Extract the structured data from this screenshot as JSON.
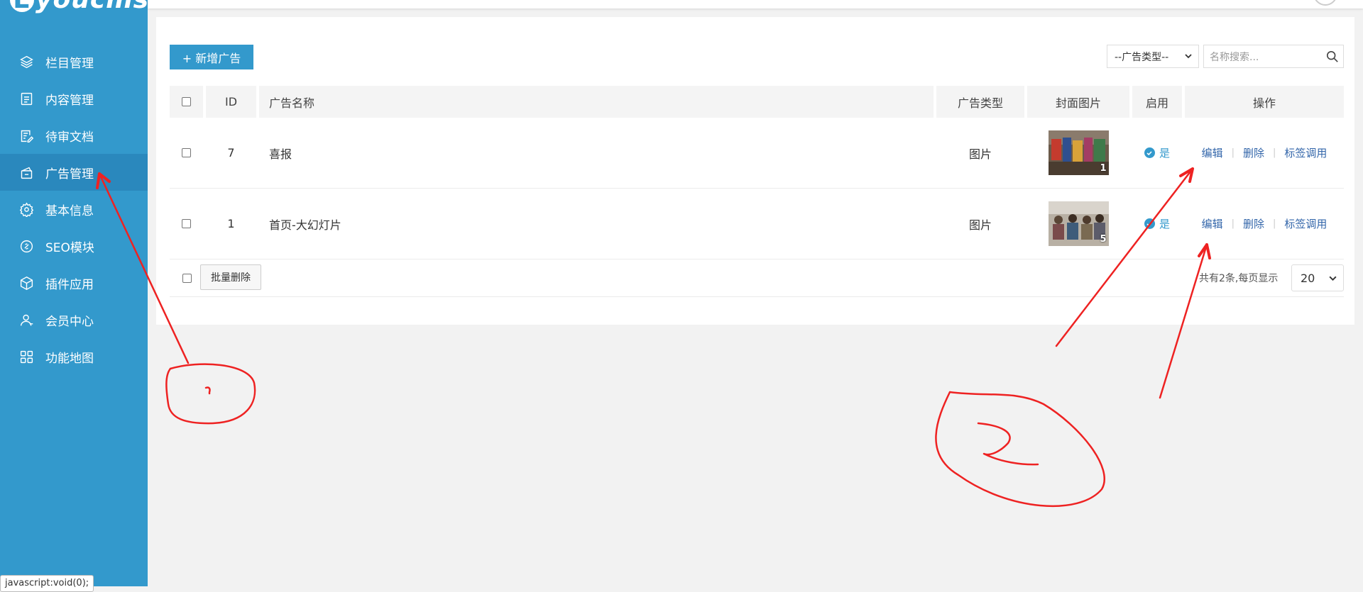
{
  "app": {
    "logo_text": "youcms",
    "logo_letter": "E"
  },
  "sidebar": {
    "items": [
      {
        "label": "栏目管理",
        "icon": "layers-icon",
        "active": false
      },
      {
        "label": "内容管理",
        "icon": "document-list-icon",
        "active": false
      },
      {
        "label": "待审文档",
        "icon": "review-document-icon",
        "active": false
      },
      {
        "label": "广告管理",
        "icon": "ad-icon",
        "active": true
      },
      {
        "label": "基本信息",
        "icon": "gear-icon",
        "active": false
      },
      {
        "label": "SEO模块",
        "icon": "seo-icon",
        "active": false
      },
      {
        "label": "插件应用",
        "icon": "cube-icon",
        "active": false
      },
      {
        "label": "会员中心",
        "icon": "user-icon",
        "active": false
      },
      {
        "label": "功能地图",
        "icon": "grid-icon",
        "active": false
      }
    ],
    "status_tip": "javascript:void(0);"
  },
  "toolbar": {
    "add_label": "+ 新增广告",
    "type_select_value": "--广告类型--",
    "search_placeholder": "名称搜索..."
  },
  "table": {
    "headers": {
      "id": "ID",
      "name": "广告名称",
      "type": "广告类型",
      "cover": "封面图片",
      "enabled": "启用",
      "ops": "操作"
    },
    "rows": [
      {
        "id": "7",
        "name": "喜报",
        "type": "图片",
        "cover_count": "1",
        "enabled": "是",
        "ops": [
          "编辑",
          "删除",
          "标签调用"
        ]
      },
      {
        "id": "1",
        "name": "首页-大幻灯片",
        "type": "图片",
        "cover_count": "5",
        "enabled": "是",
        "ops": [
          "编辑",
          "删除",
          "标签调用"
        ]
      }
    ]
  },
  "footer": {
    "batch_delete": "批量删除",
    "page_info": "共有2条,每页显示",
    "page_size": "20"
  },
  "colors": {
    "sidebar": "#3399cc",
    "sidebar_active": "#2a88bd",
    "accent": "#3399cc",
    "annotation": "#ee2222"
  }
}
